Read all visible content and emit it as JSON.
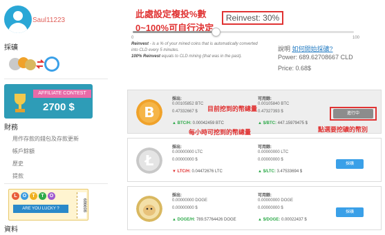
{
  "user": {
    "name": "Saul11223"
  },
  "sidebar": {
    "mining_title": "採礦",
    "contest": {
      "ribbon": "AFFILIATE CONTEST",
      "amount": "2700 $"
    },
    "finance_title": "財務",
    "finance_links": [
      "用作存款的錢包及存款更新",
      "帳戶餘額",
      "歷史",
      "提款"
    ],
    "lotto": {
      "letters": [
        "L",
        "O",
        "T",
        "T",
        "O"
      ],
      "lucky": "ARE YOU LUCKY ?",
      "number": "686698"
    },
    "info_title": "資料"
  },
  "annotations": {
    "line1": "此處設定複投%數",
    "line2": "0~100%可自行決定",
    "mined_total": "目前挖到的幣總量",
    "hourly": "每小時可挖到的幣總量",
    "click_hint": "點選要挖礦的幣別"
  },
  "reinvest": {
    "label": "Reinvest: 30%",
    "value_percent": 30,
    "min": "0",
    "max": "100",
    "desc_line1_bold": "Reinvest",
    "desc_line1": " - is a % of your mined coins that is automatically converted into CLD every 5 minutes.",
    "desc_line2_bold": "100% Reinvest",
    "desc_line2": " equals to CLD mining (that was in the past)."
  },
  "info": {
    "howto_label": "說明",
    "howto_link": "如何開始採礦?",
    "power": "Power: 689.62708667 CLD",
    "price": "Price: 0.68$"
  },
  "coins": [
    {
      "name": "BTC",
      "mined_label": "採出:",
      "mined_amount": "0.00105852 BTC",
      "mined_usd": "0.47332667 $",
      "avail_label": "可用餘:",
      "avail_amount": "0.00105840 BTC",
      "avail_usd": "0.47327393 $",
      "rate_label": "BTC/H:",
      "rate_value": "0.00042459 BTC",
      "usd_label": "$/BTC:",
      "usd_value": "447.15979475 $",
      "button": "進行中",
      "active": true
    },
    {
      "name": "LTC",
      "mined_label": "採出:",
      "mined_amount": "0.00000000 LTC",
      "mined_usd": "0.00000000 $",
      "avail_label": "可用餘:",
      "avail_amount": "0.00000000 LTC",
      "avail_usd": "0.00000000 $",
      "rate_label": "LTC/H:",
      "rate_value": "0.04472676 LTC",
      "usd_label": "$/LTC:",
      "usd_value": "3.47533694 $",
      "button": "採礦",
      "active": false
    },
    {
      "name": "DOGE",
      "mined_label": "採出:",
      "mined_amount": "0.00000000 DOGE",
      "mined_usd": "0.00000000 $",
      "avail_label": "可用餘:",
      "avail_amount": "0.00000000 DOGE",
      "avail_usd": "0.00000000 $",
      "rate_label": "DOGE/H:",
      "rate_value": "789.57764426 DOGE",
      "usd_label": "$/DOGE:",
      "usd_value": "0.00022437 $",
      "button": "採礦",
      "active": false
    }
  ],
  "colors": {
    "accent_blue": "#3aa0e8",
    "annotation_red": "#e03232",
    "positive_green": "#2eaa4a",
    "btc_orange": "#f0a22a"
  }
}
